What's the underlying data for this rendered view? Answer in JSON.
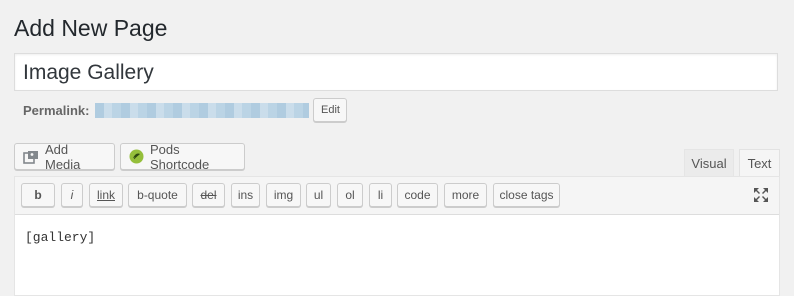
{
  "header": {
    "title": "Add New Page"
  },
  "post": {
    "title": "Image Gallery"
  },
  "permalink": {
    "label": "Permalink:",
    "edit_label": "Edit"
  },
  "media_buttons": {
    "add_media": "Add Media",
    "pods_shortcode": "Pods Shortcode"
  },
  "editor_tabs": {
    "visual": "Visual",
    "text": "Text",
    "active": "Text"
  },
  "quicktags": [
    "b",
    "i",
    "link",
    "b-quote",
    "del",
    "ins",
    "img",
    "ul",
    "ol",
    "li",
    "code",
    "more",
    "close tags"
  ],
  "content": "[gallery]",
  "icons": {
    "add_media": "add-media-icon",
    "pods": "pods-icon",
    "fullscreen": "fullscreen-icon"
  },
  "colors": {
    "background": "#f1f1f1",
    "text": "#23282d",
    "pods_green": "#95bf3b"
  }
}
